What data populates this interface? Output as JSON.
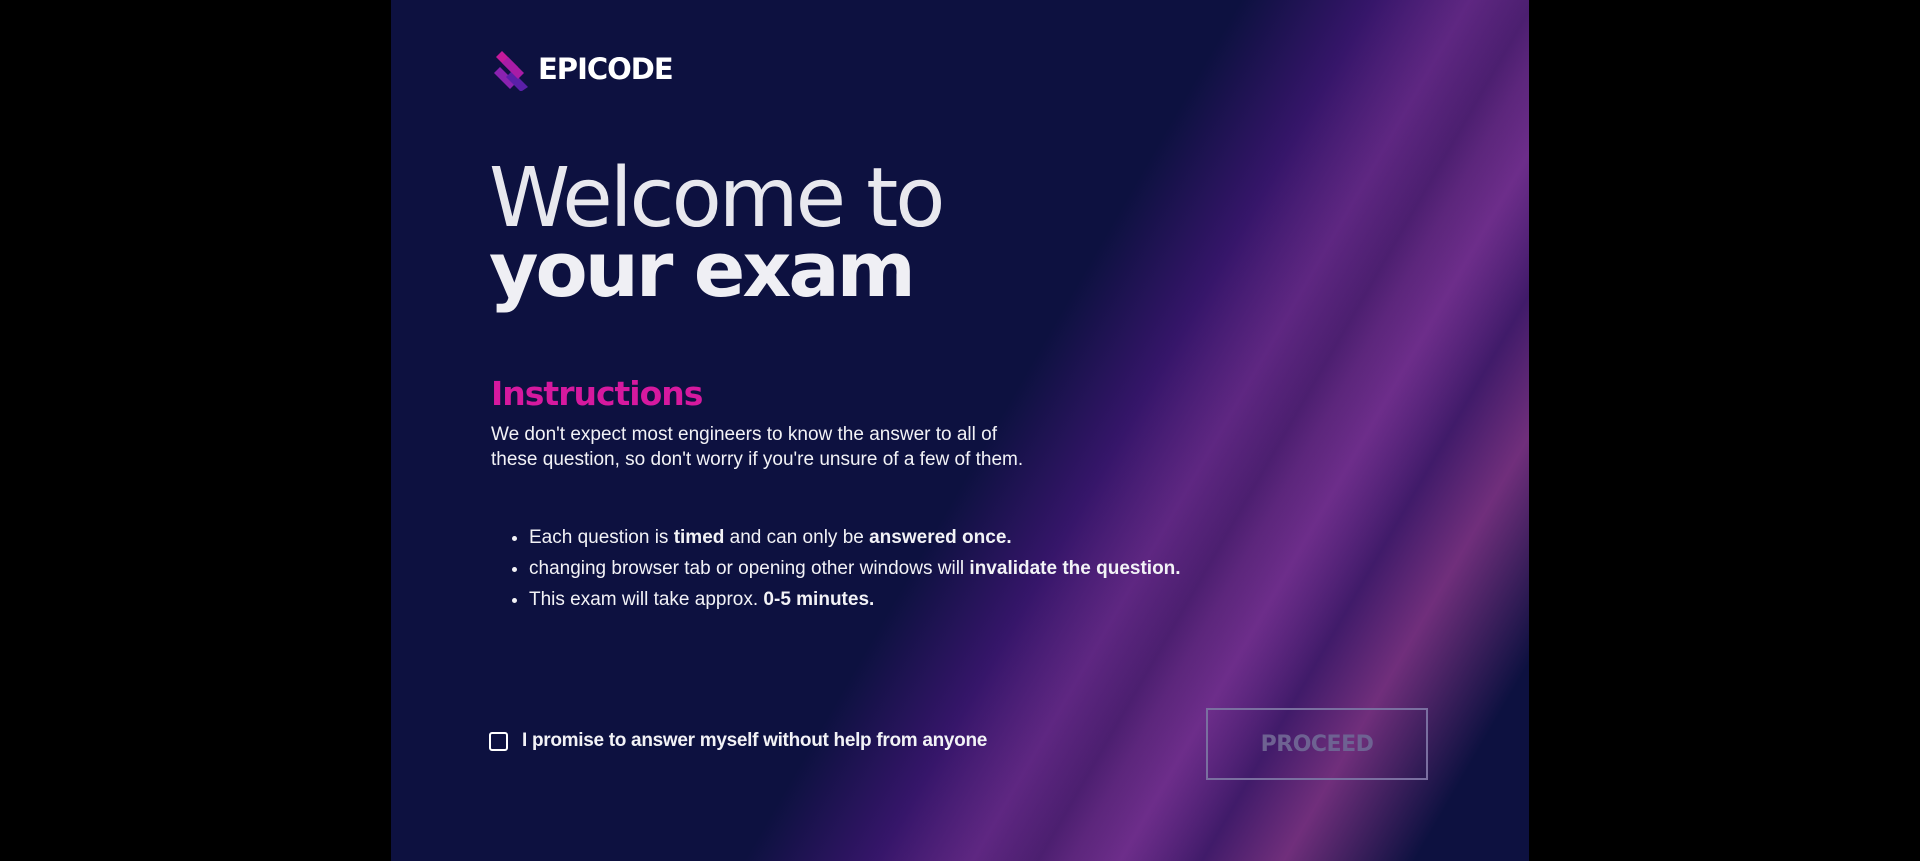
{
  "brand": {
    "name": "EPICODE",
    "logo_icon": "epicode-stripes-icon",
    "accent_color": "#d6199f",
    "background_color": "#0d1140"
  },
  "hero": {
    "line1": "Welcome to",
    "line2": "your exam"
  },
  "instructions": {
    "heading": "Instructions",
    "intro_line1": "We don't expect most engineers to know the answer to all of",
    "intro_line2": "these question, so don't worry if you're unsure of a few of them.",
    "bullets": [
      {
        "parts": [
          "Each question is ",
          "timed",
          " and can only be ",
          "answered once."
        ]
      },
      {
        "parts": [
          "changing browser tab or opening other windows will ",
          "invalidate the question."
        ]
      },
      {
        "parts": [
          "This exam will take approx. ",
          "0-5 minutes."
        ]
      }
    ]
  },
  "agreement": {
    "checked": false,
    "label": "I promise to answer myself without help from anyone"
  },
  "proceed_button": {
    "label": "PROCEED",
    "enabled": false
  }
}
